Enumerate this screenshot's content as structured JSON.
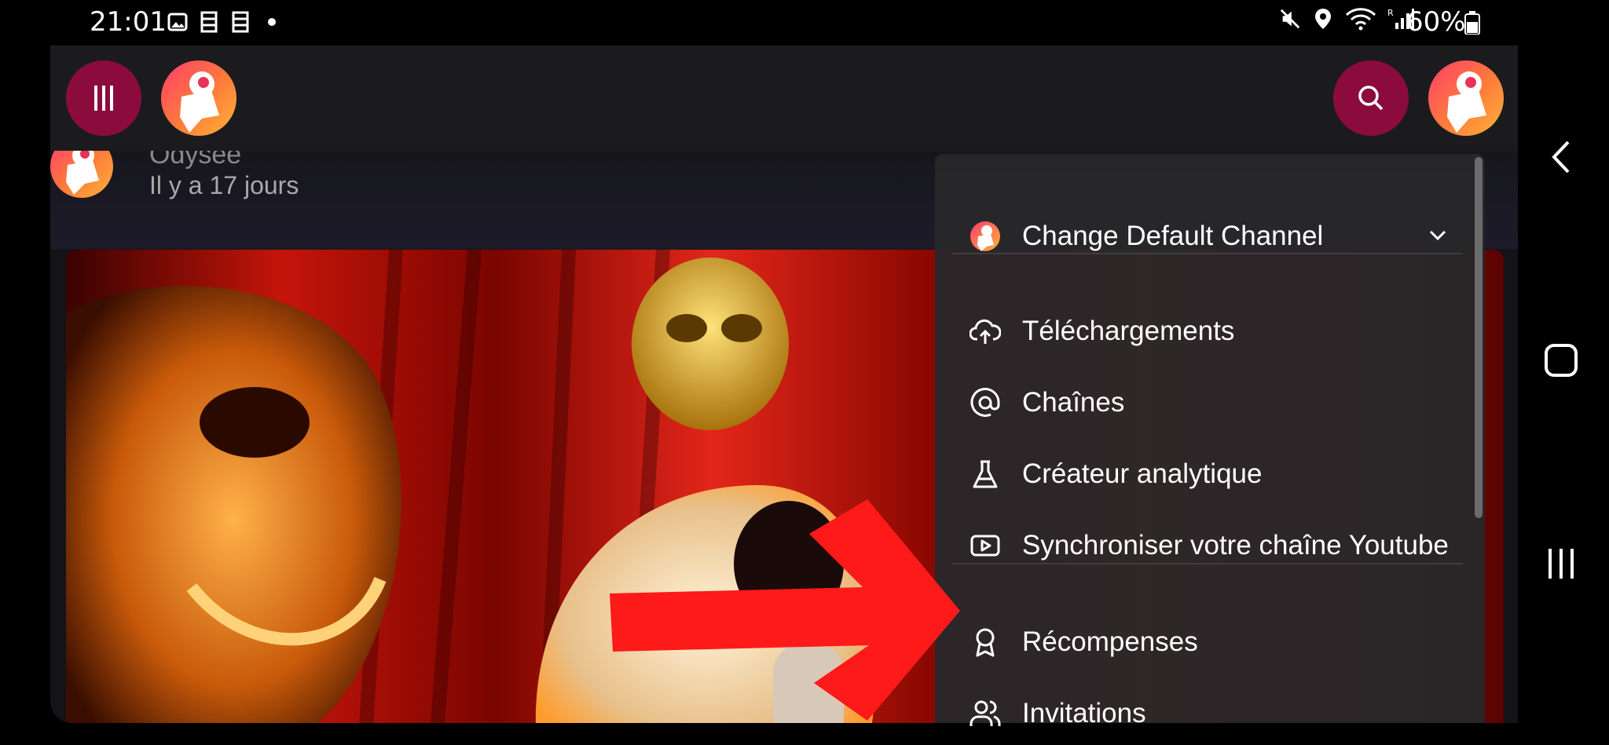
{
  "status_bar": {
    "time": "21:01",
    "left_icons": [
      "image-icon",
      "notes-icon",
      "notes-icon",
      "dot-icon"
    ],
    "right_icons": [
      "mute-icon",
      "location-icon",
      "wifi-icon",
      "signal-icon"
    ],
    "battery": "60%"
  },
  "header": {
    "menu_button_icon": "menu-icon",
    "search_button_icon": "search-icon",
    "accent_color": "#8c0b3d"
  },
  "post": {
    "channel_name": "Odysee",
    "time_ago": "Il y a 17 jours"
  },
  "menu": {
    "channel_selector": "Change Default Channel",
    "items_group_1": [
      {
        "label": "Téléchargements",
        "icon": "cloud-upload-icon"
      },
      {
        "label": "Chaînes",
        "icon": "at-icon"
      },
      {
        "label": "Créateur analytique",
        "icon": "flask-icon"
      },
      {
        "label": "Synchroniser votre chaîne Youtube",
        "icon": "youtube-icon"
      }
    ],
    "items_group_2": [
      {
        "label": "Récompenses",
        "icon": "award-icon"
      },
      {
        "label": "Invitations",
        "icon": "users-icon"
      }
    ]
  },
  "annotation": {
    "arrow_color": "#ff1a1a"
  }
}
